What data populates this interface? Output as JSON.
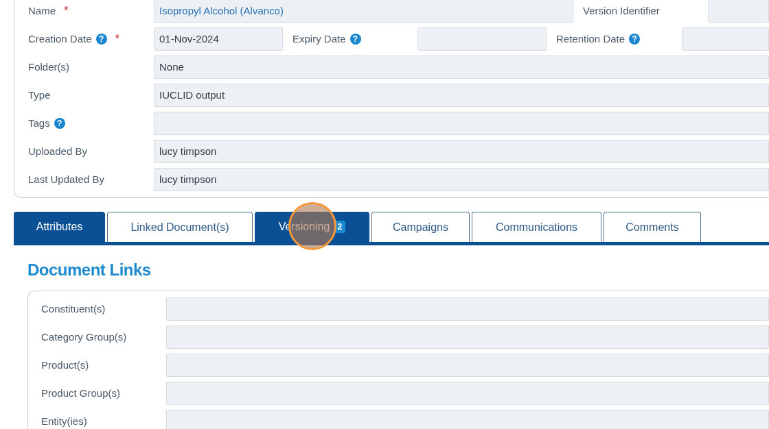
{
  "details": {
    "rows": [
      {
        "fields": [
          {
            "label": "Name",
            "required_mark": "*",
            "value": "Isopropyl Alcohol (Alvanco)",
            "link": true
          },
          {
            "label": "Version Identifier"
          }
        ]
      },
      {
        "fields": [
          {
            "label": "Creation Date",
            "help": "?",
            "required_mark": "*",
            "value": "01-Nov-2024",
            "link": false
          },
          {
            "label": "Expiry Date",
            "help": "?"
          },
          {
            "label": "Retention Date",
            "help": "?"
          }
        ]
      },
      {
        "fields": [
          {
            "label": "Folder(s)",
            "value": "None",
            "link": false
          }
        ]
      },
      {
        "fields": [
          {
            "label": "Type",
            "value": "IUCLID output",
            "link": false
          }
        ]
      },
      {
        "fields": [
          {
            "label": "Tags",
            "help": "?"
          }
        ]
      },
      {
        "fields": [
          {
            "label": "Uploaded By",
            "value": "lucy timpson",
            "link": false
          }
        ]
      },
      {
        "fields": [
          {
            "label": "Last Updated By",
            "value": "lucy timpson",
            "link": false
          }
        ]
      }
    ]
  },
  "tabs": [
    {
      "label": "Attributes",
      "selected": true
    },
    {
      "label": "Linked Document(s)",
      "selected": false
    },
    {
      "label": "Versioning",
      "selected": true,
      "count": "2"
    },
    {
      "label": "Campaigns",
      "selected": false
    },
    {
      "label": "Communications",
      "selected": false
    },
    {
      "label": "Comments",
      "selected": false
    }
  ],
  "document_links": {
    "title": "Document Links",
    "rows": [
      {
        "label": "Constituent(s)"
      },
      {
        "label": "Category Group(s)"
      },
      {
        "label": "Product(s)"
      },
      {
        "label": "Product Group(s)"
      },
      {
        "label": "Entity(ies)"
      }
    ]
  }
}
